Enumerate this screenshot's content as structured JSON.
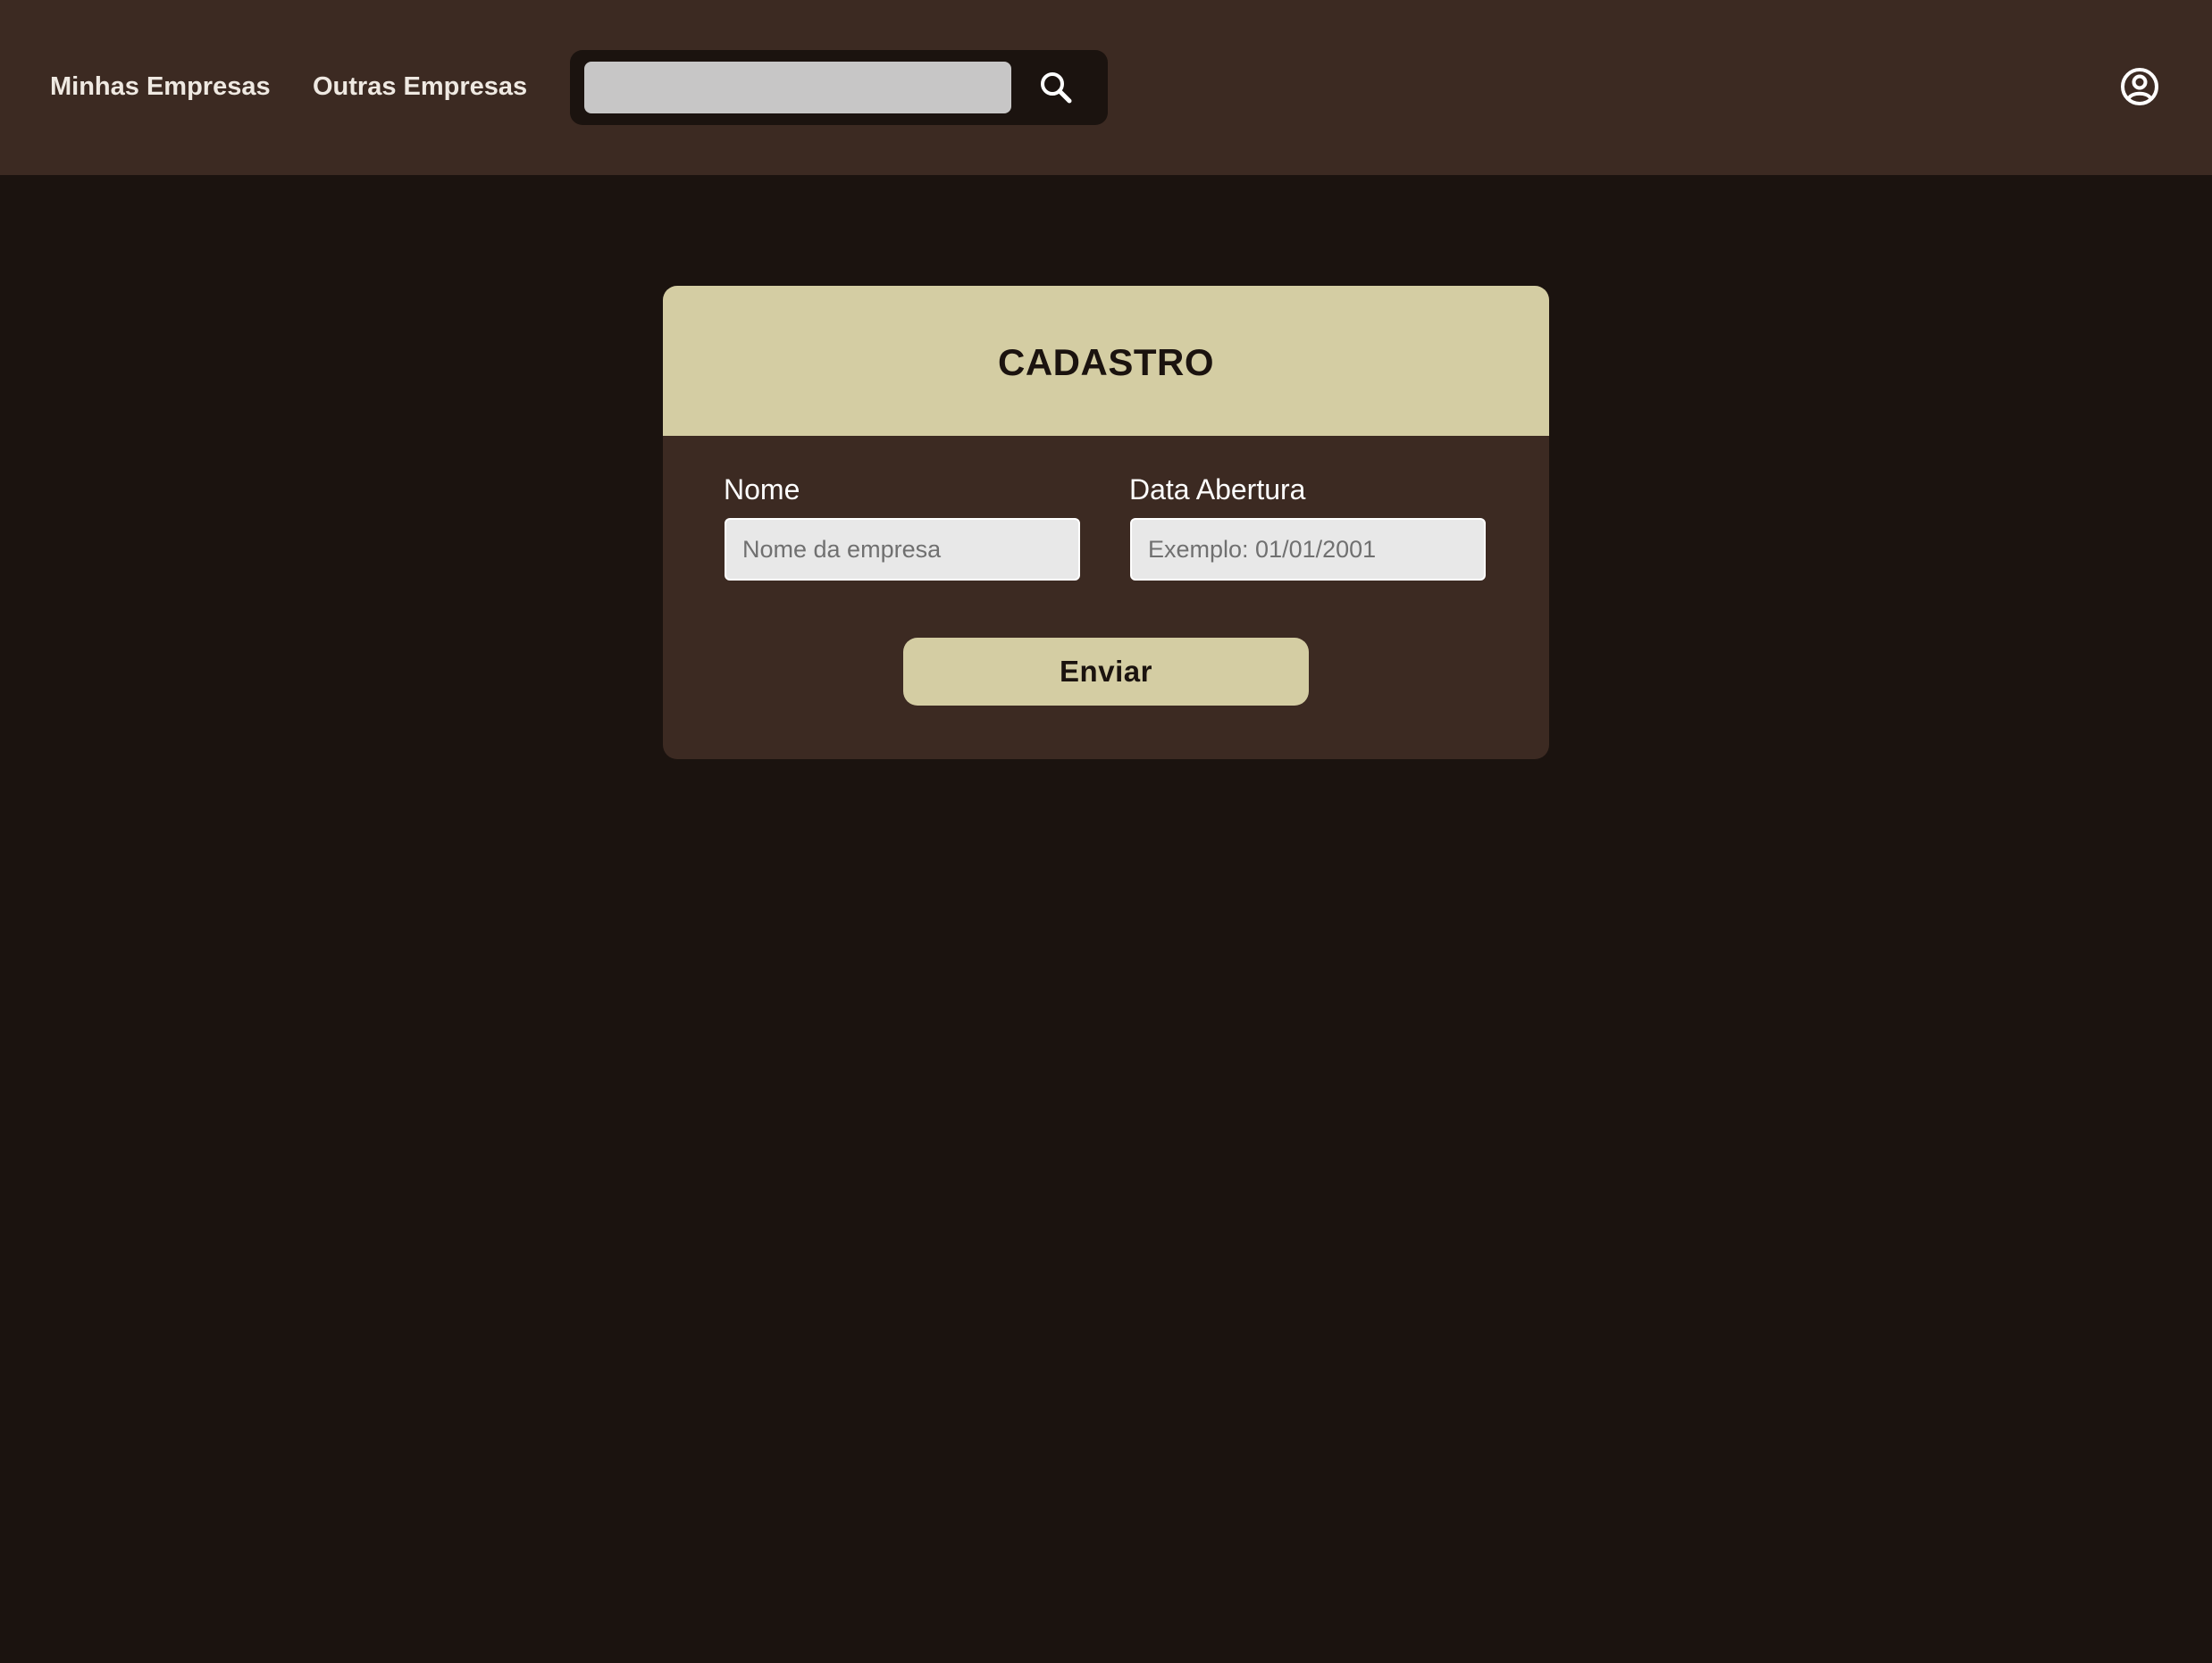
{
  "nav": {
    "links": [
      {
        "label": "Minhas Empresas"
      },
      {
        "label": "Outras Empresas"
      }
    ],
    "search": {
      "value": "",
      "placeholder": "",
      "icon": "search-icon"
    },
    "user_icon": "user-circle-icon"
  },
  "form": {
    "title": "CADASTRO",
    "fields": {
      "nome": {
        "label": "Nome",
        "value": "",
        "placeholder": "Nome da empresa"
      },
      "data_abertura": {
        "label": "Data Abertura",
        "value": "",
        "placeholder": "Exemplo: 01/01/2001"
      }
    },
    "submit_label": "Enviar"
  },
  "colors": {
    "background": "#1b130f",
    "surface": "#3c2a22",
    "accent": "#d4cda3",
    "input": "#e8e8e8",
    "search_input": "#c7c6c6"
  }
}
